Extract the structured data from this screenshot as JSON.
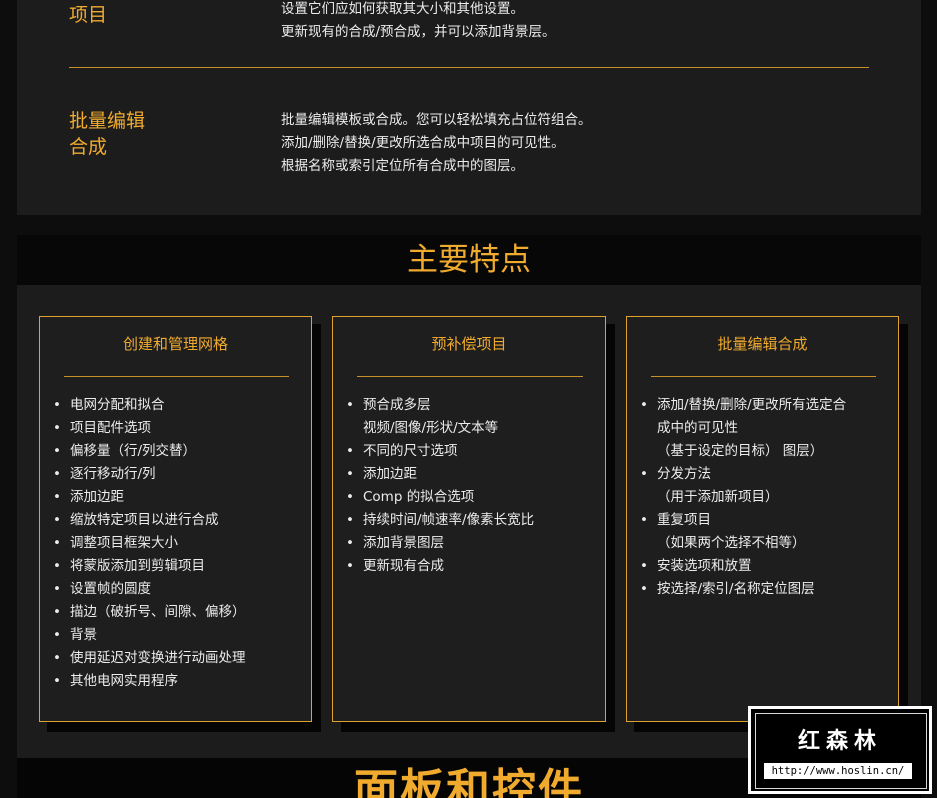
{
  "top": {
    "row1_title": "项目",
    "row1_lines": [
      "设置它们应如何获取其大小和其他设置。",
      "更新现有的合成/预合成，并可以添加背景层。"
    ],
    "row2_title_lines": [
      "批量编辑",
      "合成"
    ],
    "row2_lines": [
      "批量编辑模板或合成。您可以轻松填充占位符组合。",
      "添加/删除/替换/更改所选合成中项目的可见性。",
      "根据名称或索引定位所有合成中的图层。"
    ]
  },
  "features_heading": "主要特点",
  "cards": [
    {
      "title": "创建和管理网格",
      "items": [
        [
          "电网分配和拟合"
        ],
        [
          "项目配件选项"
        ],
        [
          "偏移量（行/列交替）"
        ],
        [
          "逐行移动行/列"
        ],
        [
          "添加边距"
        ],
        [
          "缩放特定项目以进行合成"
        ],
        [
          "调整项目框架大小"
        ],
        [
          "将蒙版添加到剪辑项目"
        ],
        [
          "设置帧的圆度"
        ],
        [
          "描边（破折号、间隙、偏移）"
        ],
        [
          "背景"
        ],
        [
          "使用延迟对变换进行动画处理"
        ],
        [
          "其他电网实用程序"
        ]
      ]
    },
    {
      "title": "预补偿项目",
      "items": [
        [
          "预合成多层",
          "视频/图像/形状/文本等"
        ],
        [
          "不同的尺寸选项"
        ],
        [
          "添加边距"
        ],
        [
          "Comp 的拟合选项"
        ],
        [
          "持续时间/帧速率/像素长宽比"
        ],
        [
          "添加背景图层"
        ],
        [
          "更新现有合成"
        ]
      ]
    },
    {
      "title": "批量编辑合成",
      "items": [
        [
          "添加/替换/删除/更改所有选定合",
          "成中的可见性",
          "（基于设定的目标） 图层）"
        ],
        [
          "分发方法",
          "（用于添加新项目）"
        ],
        [
          "重复项目",
          "（如果两个选择不相等）"
        ],
        [
          "安装选项和放置"
        ],
        [
          "按选择/索引/名称定位图层"
        ]
      ]
    }
  ],
  "bottom_heading": "面板和控件",
  "watermark": {
    "title": "红森林",
    "url": "http://www.hoslin.cn/"
  }
}
